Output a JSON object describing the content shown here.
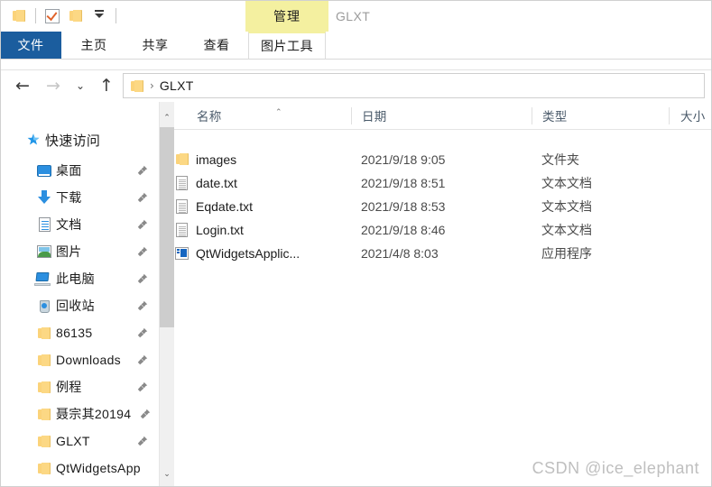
{
  "window": {
    "title": "GLXT",
    "contextual_tab": "管理",
    "contextual_group": "图片工具"
  },
  "quick_access_toolbar": {
    "items": [
      {
        "name": "folder-icon",
        "tooltip": "属性"
      },
      {
        "name": "properties-icon",
        "tooltip": "属性"
      },
      {
        "name": "new-folder-icon",
        "tooltip": "新建文件夹"
      },
      {
        "name": "customize-dropdown-icon",
        "tooltip": "自定义快速访问工具栏"
      }
    ]
  },
  "ribbon": {
    "tabs": [
      {
        "label": "文件",
        "active": true
      },
      {
        "label": "主页",
        "active": false
      },
      {
        "label": "共享",
        "active": false
      },
      {
        "label": "查看",
        "active": false
      },
      {
        "label": "图片工具",
        "active": false,
        "contextual": true
      }
    ]
  },
  "navigation": {
    "back_icon": "←",
    "forward_icon": "→",
    "recent_icon": "⌄",
    "up_icon": "↑",
    "address": {
      "separator": "›",
      "crumbs": [
        "GLXT"
      ]
    }
  },
  "sidebar": {
    "header": {
      "label": "快速访问",
      "icon": "star-icon"
    },
    "items": [
      {
        "label": "桌面",
        "icon": "desktop-icon",
        "pinned": true
      },
      {
        "label": "下载",
        "icon": "downloads-icon",
        "pinned": true
      },
      {
        "label": "文档",
        "icon": "documents-icon",
        "pinned": true
      },
      {
        "label": "图片",
        "icon": "pictures-icon",
        "pinned": true
      },
      {
        "label": "此电脑",
        "icon": "this-pc-icon",
        "pinned": true
      },
      {
        "label": "回收站",
        "icon": "recycle-bin-icon",
        "pinned": true
      },
      {
        "label": "86135",
        "icon": "folder-icon",
        "pinned": true
      },
      {
        "label": "Downloads",
        "icon": "folder-icon",
        "pinned": true
      },
      {
        "label": "例程",
        "icon": "folder-icon",
        "pinned": true
      },
      {
        "label": "聂宗其20194",
        "icon": "folder-icon",
        "pinned": true
      },
      {
        "label": "GLXT",
        "icon": "folder-icon",
        "pinned": true
      },
      {
        "label": "QtWidgetsApp",
        "icon": "folder-icon",
        "pinned": false
      }
    ],
    "scrollbar": {
      "up_arrow": "⌃",
      "down_arrow": "⌄"
    }
  },
  "file_list": {
    "columns": [
      {
        "label": "名称",
        "sorted": "asc",
        "sort_glyph": "⌃"
      },
      {
        "label": "日期",
        "sorted": ""
      },
      {
        "label": "类型",
        "sorted": ""
      },
      {
        "label": "大小",
        "sorted": ""
      }
    ],
    "rows": [
      {
        "name": "images",
        "date": "2021/9/18 9:05",
        "type": "文件夹",
        "icon": "folder-icon"
      },
      {
        "name": "date.txt",
        "date": "2021/9/18 8:51",
        "type": "文本文档",
        "icon": "text-file-icon"
      },
      {
        "name": "Eqdate.txt",
        "date": "2021/9/18 8:53",
        "type": "文本文档",
        "icon": "text-file-icon"
      },
      {
        "name": "Login.txt",
        "date": "2021/9/18 8:46",
        "type": "文本文档",
        "icon": "text-file-icon"
      },
      {
        "name": "QtWidgetsApplic...",
        "date": "2021/4/8 8:03",
        "type": "应用程序",
        "icon": "application-icon"
      }
    ]
  },
  "watermark": {
    "text": "CSDN @ice_elephant"
  },
  "colors": {
    "file_tab_blue": "#1b5d9e",
    "contextual_yellow": "#f4f0a0",
    "folder_yellow": "#fcd884",
    "accent_blue": "#2b8fe0",
    "watermark_gray": "#bfbfbf"
  }
}
